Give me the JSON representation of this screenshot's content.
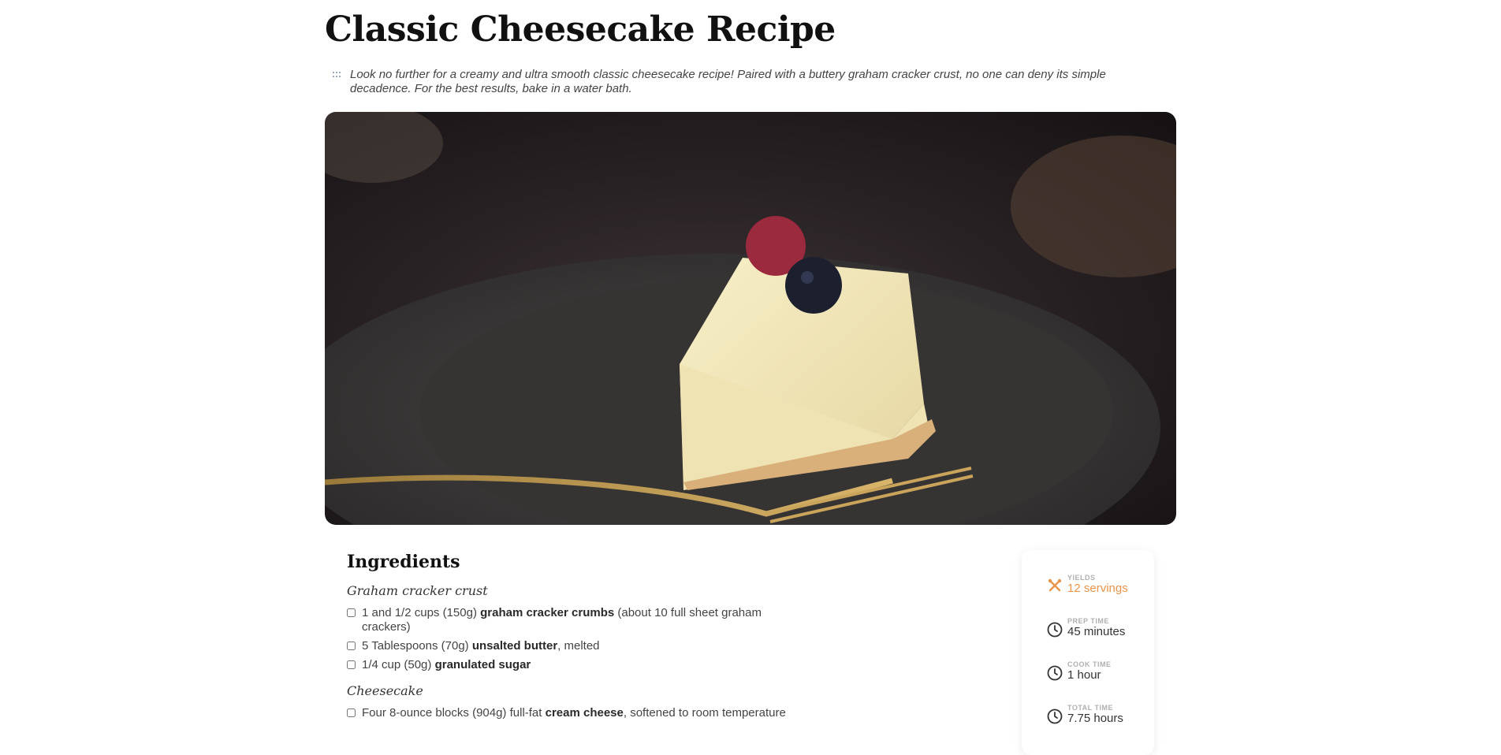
{
  "title": "Classic Cheesecake Recipe",
  "intro": "Look no further for a creamy and ultra smooth classic cheesecake recipe! Paired with a buttery graham cracker crust, no one can deny its simple decadence. For the best results, bake in a water bath.",
  "ingredients": {
    "heading": "Ingredients",
    "groups": [
      {
        "title": "Graham cracker crust",
        "items": [
          {
            "pre": "1 and 1/2 cups (150g) ",
            "bold": "graham cracker crumbs",
            "post": " (about 10 full sheet graham crackers)"
          },
          {
            "pre": "5 Tablespoons (70g) ",
            "bold": "unsalted butter",
            "post": ", melted"
          },
          {
            "pre": "1/4 cup (50g) ",
            "bold": "granulated sugar",
            "post": ""
          }
        ]
      },
      {
        "title": "Cheesecake",
        "items": [
          {
            "pre": "Four 8-ounce blocks (904g) full-fat ",
            "bold": "cream cheese",
            "post": ", softened to room temperature"
          }
        ]
      }
    ]
  },
  "stats": [
    {
      "label": "YIELDS",
      "value": "12 servings",
      "icon": "utensils-icon",
      "accent": true
    },
    {
      "label": "PREP TIME",
      "value": "45 minutes",
      "icon": "clock-icon",
      "accent": false
    },
    {
      "label": "COOK TIME",
      "value": "1 hour",
      "icon": "clock-icon",
      "accent": false
    },
    {
      "label": "TOTAL TIME",
      "value": "7.75 hours",
      "icon": "clock-icon",
      "accent": false
    }
  ],
  "colors": {
    "accent": "#e8954a",
    "title": "#111111",
    "text": "#3a3a3a"
  }
}
